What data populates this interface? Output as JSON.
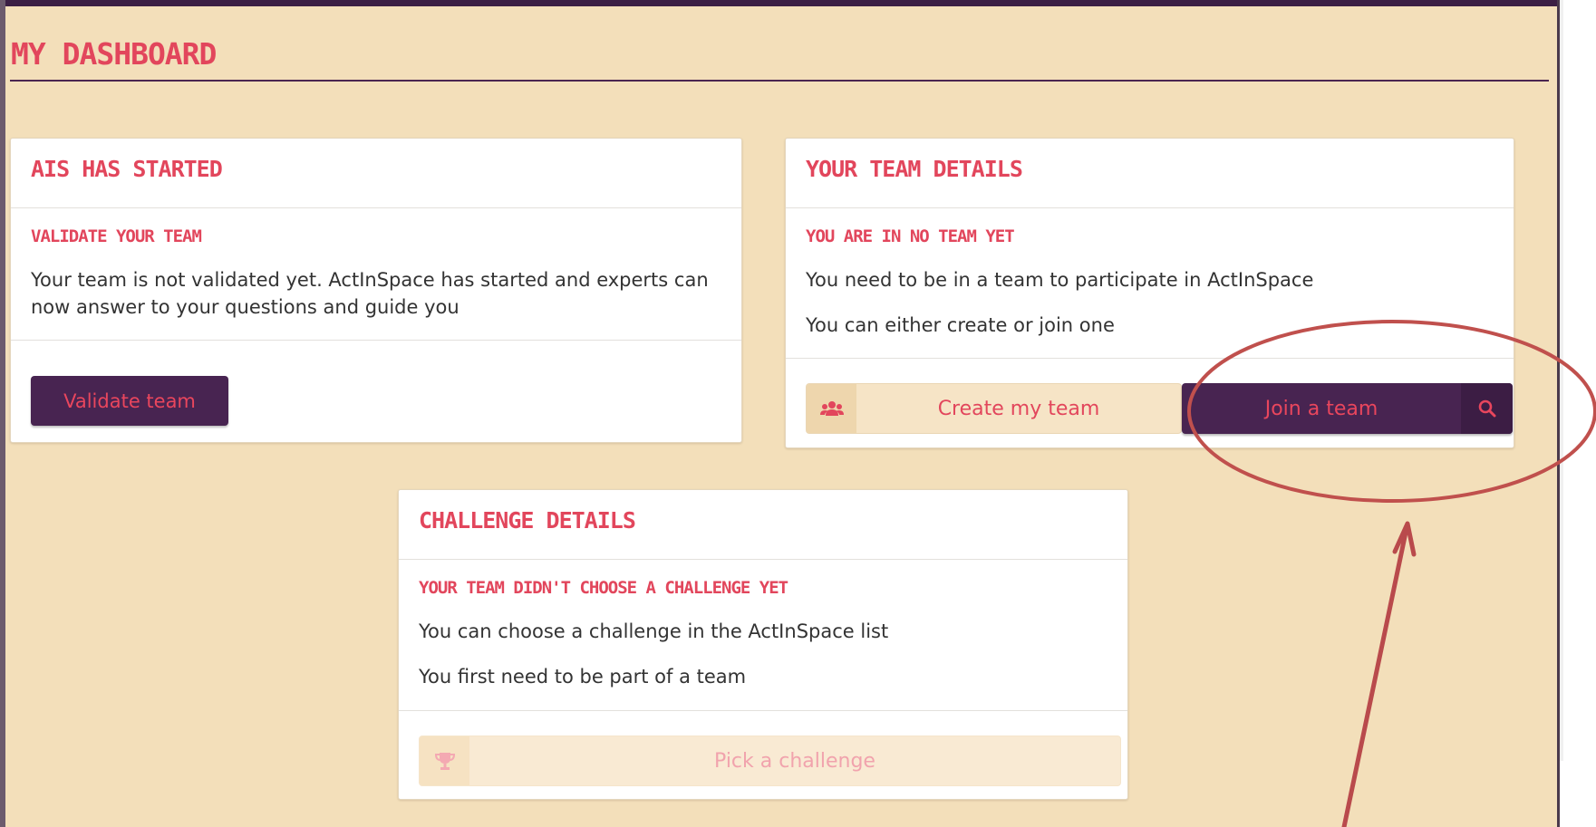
{
  "page": {
    "title": "MY DASHBOARD"
  },
  "cards": {
    "ais_started": {
      "title": "AIS HAS STARTED",
      "subtitle": "VALIDATE YOUR TEAM",
      "text": "Your team is not validated yet. ActInSpace has started and experts can now answer to your questions and guide you",
      "button_label": "Validate team"
    },
    "team_details": {
      "title": "YOUR TEAM DETAILS",
      "subtitle": "YOU ARE IN NO TEAM YET",
      "text1": "You need to be in a team to participate in ActInSpace",
      "text2": "You can either create or join one",
      "create_label": "Create my team",
      "create_icon": "users-icon",
      "join_label": "Join a team",
      "join_icon": "search-icon"
    },
    "challenge_details": {
      "title": "CHALLENGE DETAILS",
      "subtitle": "YOUR TEAM DIDN'T CHOOSE A CHALLENGE YET",
      "text1": "You can choose a challenge in the ActInSpace list",
      "text2": "You first need to be part of a team",
      "pick_label": "Pick a challenge",
      "pick_icon": "trophy-icon",
      "pick_disabled": true
    }
  },
  "annotation": {
    "shape": "ellipse-and-arrow",
    "target": "join-a-team-button",
    "color": "#c0504d"
  },
  "colors": {
    "background": "#f3dfba",
    "accent": "#e2465c",
    "primary_button": "#482451",
    "top_bar": "#3b1f44"
  }
}
